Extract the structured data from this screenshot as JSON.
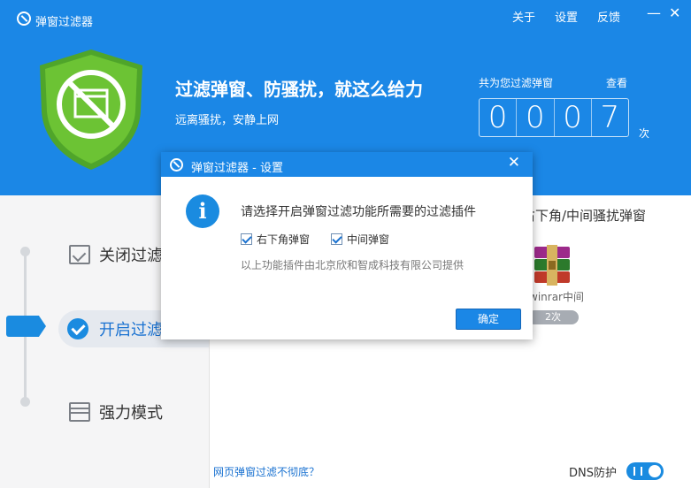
{
  "app": {
    "title": "弹窗过滤器",
    "top_links": [
      "关于",
      "设置",
      "反馈"
    ],
    "minimize_glyph": "—",
    "close_glyph": "✕"
  },
  "hero": {
    "headline": "过滤弹窗、防骚扰，就这么给力",
    "subline": "远离骚扰，安静上网",
    "count_label": "共为您过滤弹窗",
    "view_link": "查看",
    "count_digits": [
      "0",
      "0",
      "0",
      "7"
    ],
    "count_unit": "次"
  },
  "modes": {
    "off_label": "关闭过滤",
    "on_label": "开启过滤",
    "strong_label": "强力模式"
  },
  "right_panel": {
    "title": "右下角/中间骚扰弹窗",
    "app_name": "winrar中间",
    "app_count": "2次"
  },
  "footer": {
    "help_link": "网页弹窗过滤不彻底？",
    "dns_label": "DNS防护",
    "dns_enabled": true
  },
  "dialog": {
    "title": "弹窗过滤器 - 设置",
    "close_glyph": "✕",
    "info_glyph": "i",
    "message": "请选择开启弹窗过滤功能所需要的过滤插件",
    "options": [
      {
        "label": "右下角弹窗",
        "checked": true
      },
      {
        "label": "中间弹窗",
        "checked": true
      }
    ],
    "provider": "以上功能插件由北京欣和智成科技有限公司提供",
    "ok_label": "确定"
  },
  "colors": {
    "brand_blue": "#1b87e6",
    "shield_green": "#6cc334"
  }
}
